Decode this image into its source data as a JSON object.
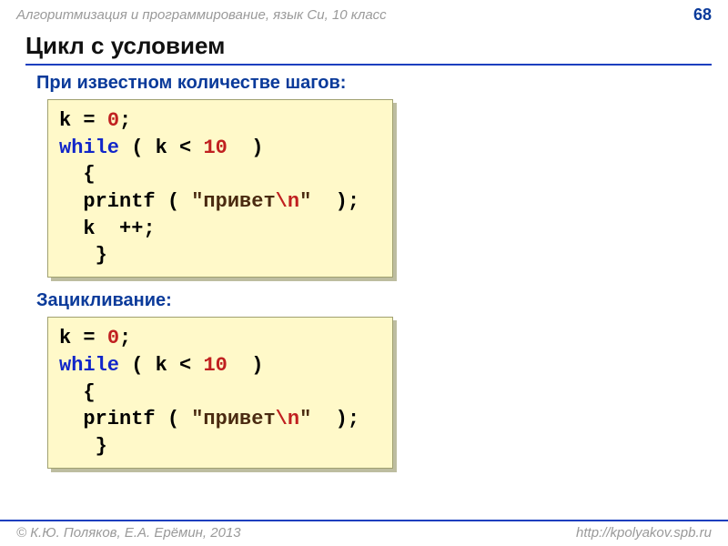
{
  "header": {
    "course": "Алгоритмизация и программирование, язык Си, 10 класс",
    "page": "68"
  },
  "title": "Цикл с условием",
  "section1_title": "При известном количестве шагов:",
  "section2_title": "Зацикливание:",
  "code1": {
    "l1a": "k = ",
    "l1b": "0",
    "l1c": ";",
    "l2a": "while",
    "l2b": " ( k < ",
    "l2c": "10",
    "l2d": "  )",
    "l3": "  {",
    "l4a": "  ",
    "l4b": "printf",
    "l4c": " ( ",
    "l4d": "\"привет",
    "l4e": "\\n",
    "l4f": "\"",
    "l4g": "  );",
    "l5": "  k  ++;",
    "l6": "   }"
  },
  "code2": {
    "l1a": "k = ",
    "l1b": "0",
    "l1c": ";",
    "l2a": "while",
    "l2b": " ( k < ",
    "l2c": "10",
    "l2d": "  )",
    "l3": "  {",
    "l4a": "  ",
    "l4b": "printf",
    "l4c": " ( ",
    "l4d": "\"привет",
    "l4e": "\\n",
    "l4f": "\"",
    "l4g": "  );",
    "l5": "   }"
  },
  "footer": {
    "author": "© К.Ю. Поляков, Е.А. Ерёмин, 2013",
    "url": "http://kpolyakov.spb.ru"
  }
}
